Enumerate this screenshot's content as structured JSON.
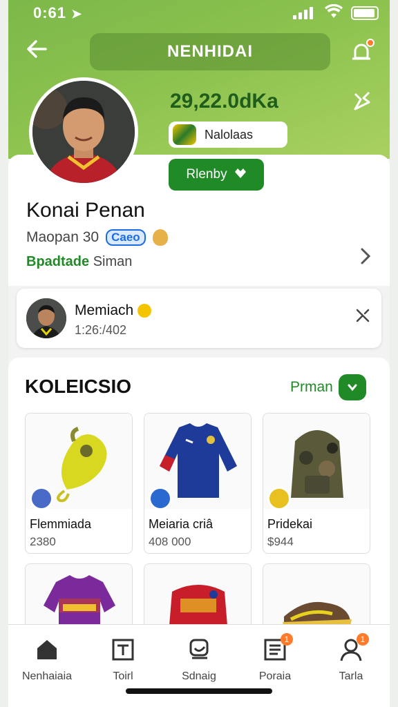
{
  "status_bar": {
    "time": "0:61",
    "arrow": "➤"
  },
  "header": {
    "title": "NENHIDAI",
    "back_icon": "back-arrow-icon",
    "bell_icon": "bell-icon",
    "share_icon": "share-icon"
  },
  "profile": {
    "stat": "29,22.0dKa",
    "tag_label": "Nalolaas",
    "cta_label": "Rlenby",
    "name": "Konai Penan",
    "subtitle": "Maopan 30",
    "chip": "Caeo",
    "status_prefix": "Bpadtade",
    "status_suffix": "Siman"
  },
  "mini_card": {
    "name": "Memiach",
    "date": "1:26:/402"
  },
  "collection": {
    "title": "KOLEICSIO",
    "link_label": "Prman",
    "items": [
      {
        "name": "Flemmiada",
        "value": "2380"
      },
      {
        "name": "Meiaria criâ",
        "value": "408 000"
      },
      {
        "name": "Pridekai",
        "value": "$944"
      }
    ]
  },
  "nav": {
    "tabs": [
      {
        "label": "Nenhaiaia",
        "icon": "home-icon"
      },
      {
        "label": "Toirl",
        "icon": "store-icon"
      },
      {
        "label": "Sdnaig",
        "icon": "scan-icon"
      },
      {
        "label": "Poraia",
        "icon": "list-icon",
        "badge": "1"
      },
      {
        "label": "Tarla",
        "icon": "profile-icon",
        "badge": "1"
      }
    ]
  },
  "colors": {
    "brand_green": "#1f8a26",
    "header_green": "#8cc24e",
    "badge_orange": "#ff7a2a"
  }
}
